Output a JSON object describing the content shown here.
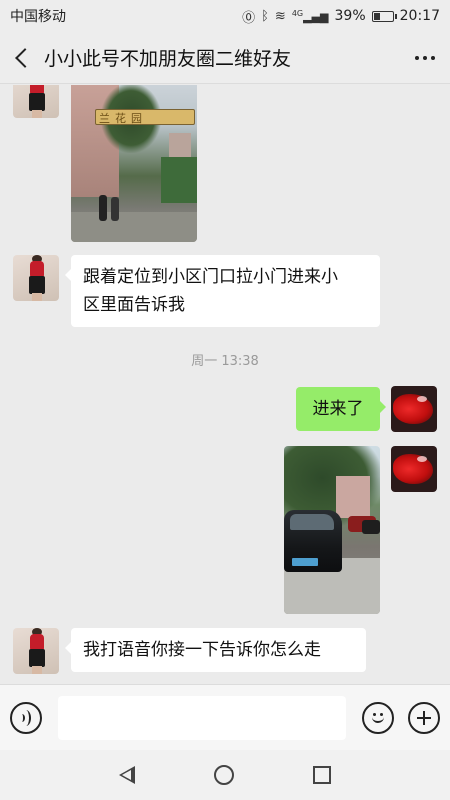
{
  "status_bar": {
    "carrier": "中国移动",
    "network": "4G",
    "battery_percent": "39%",
    "battery_level": 0.39,
    "time": "20:17"
  },
  "header": {
    "title": "小小此号不加朋友圈二维好友",
    "back_icon": "chevron-left-icon",
    "more_icon": "more-horizontal-icon"
  },
  "messages": [
    {
      "side": "left",
      "type": "image",
      "description": "photo-community-gate",
      "sign_text": "兰花园"
    },
    {
      "side": "left",
      "type": "text",
      "lines": [
        "跟着定位到小区门口拉小门进来小",
        "区里面告诉我"
      ]
    },
    {
      "side": "center",
      "type": "timestamp",
      "text": "周一 13:38"
    },
    {
      "side": "right",
      "type": "text",
      "text": "进来了"
    },
    {
      "side": "right",
      "type": "image",
      "description": "photo-parked-car"
    },
    {
      "side": "left",
      "type": "text",
      "text": "我打语音你接一下告诉你怎么走"
    }
  ],
  "input_bar": {
    "voice_icon": "voice-icon",
    "emoji_icon": "emoji-icon",
    "plus_icon": "plus-icon",
    "placeholder": ""
  },
  "colors": {
    "background": "#ebebeb",
    "bubble_left": "#ffffff",
    "bubble_right": "#95ec69",
    "bar": "#ededed"
  }
}
